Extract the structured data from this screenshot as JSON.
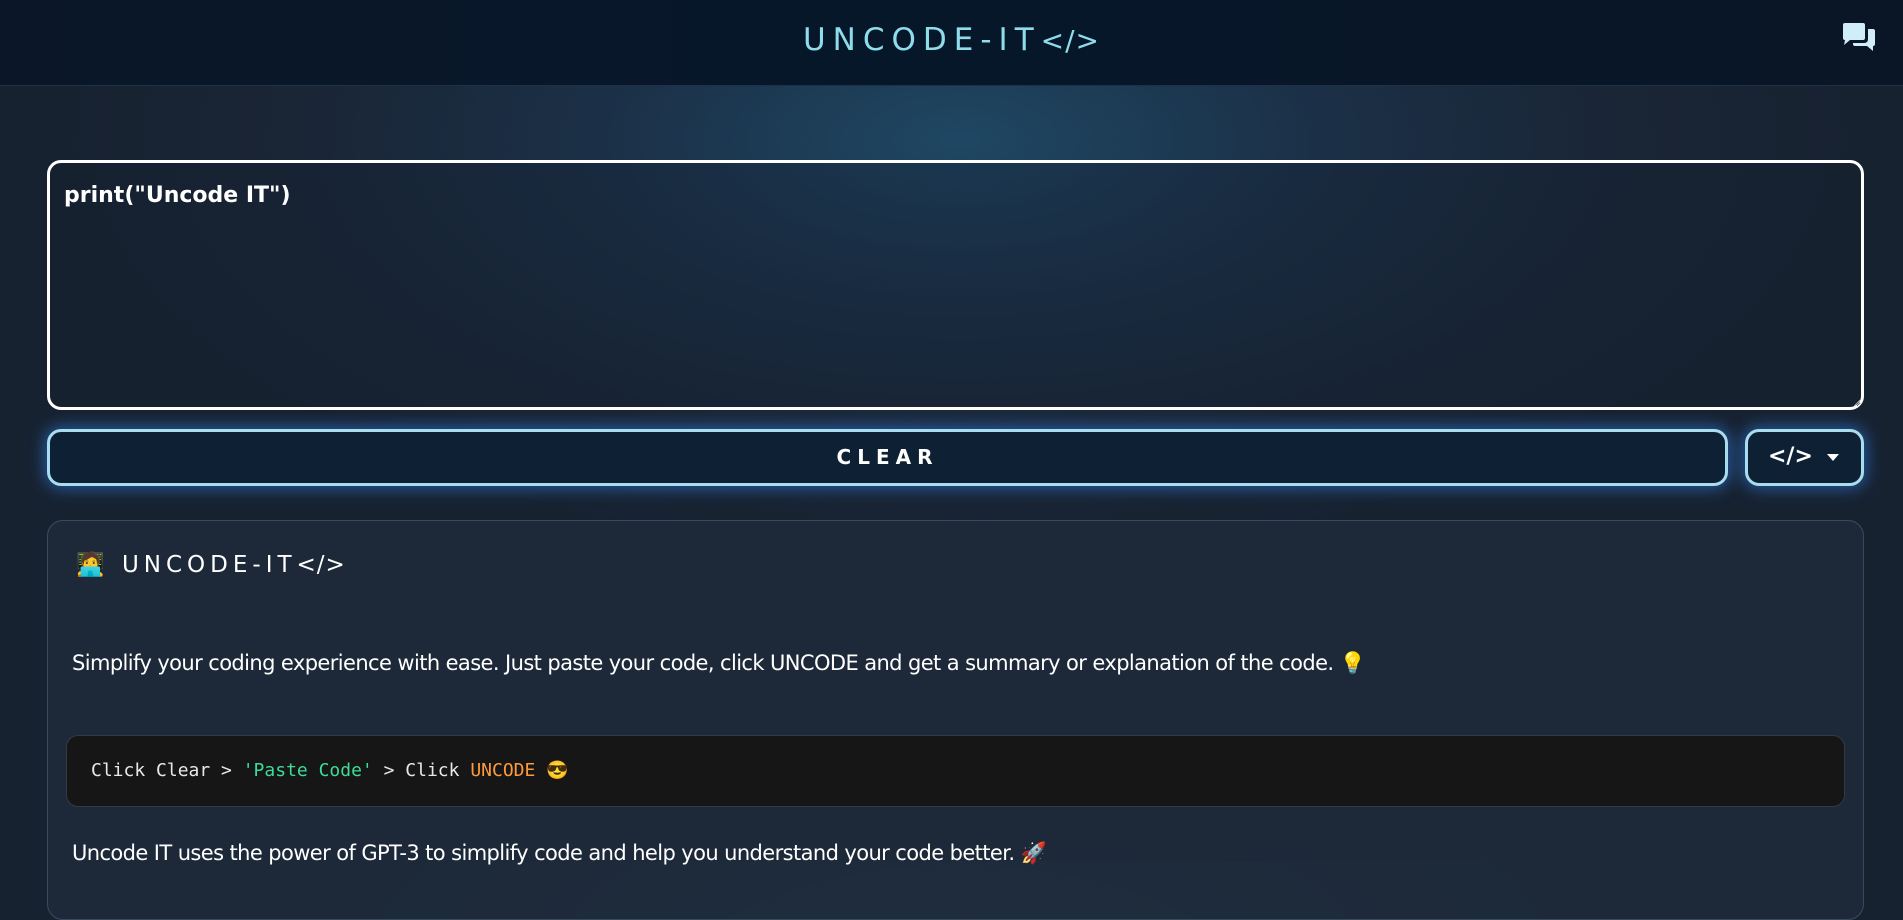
{
  "header": {
    "title": "UNCODE-IT",
    "title_tag": "</>",
    "chat_icon": "chat-bubbles-icon"
  },
  "editor": {
    "value": "print(\"Uncode IT\")"
  },
  "controls": {
    "clear_label": "CLEAR",
    "language_glyph": "</>"
  },
  "card": {
    "title_emoji": "🧑‍💻",
    "title": "UNCODE-IT",
    "title_tag": "</>",
    "description": "Simplify your coding experience with ease. Just paste your code, click UNCODE and get a summary or explanation of the code. 💡",
    "code_example": {
      "part1": "Click Clear > ",
      "part2": "'Paste Code'",
      "part3": " > Click ",
      "part4": "UNCODE",
      "part5": " 😎"
    },
    "footer": "Uncode IT uses the power of GPT-3 to simplify code and help you understand your code better. 🚀"
  },
  "colors": {
    "accent": "#8fdcea",
    "string_token": "#3ddc97",
    "keyword_token": "#ff9a3c",
    "glow": "#358cff"
  }
}
